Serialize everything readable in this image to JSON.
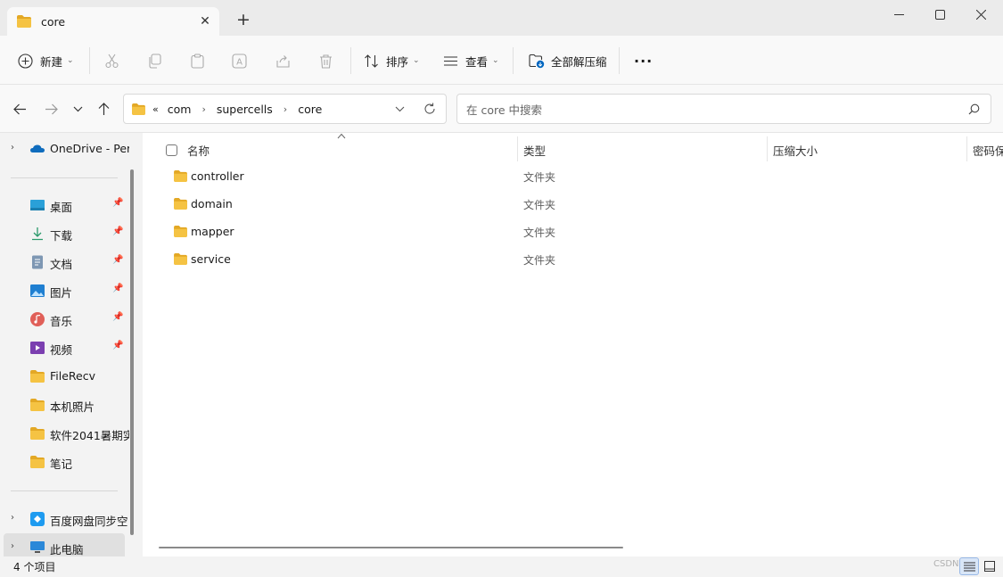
{
  "window": {
    "tab_title": "core",
    "new_tab_symbol": "+",
    "close_tab_symbol": "✕"
  },
  "toolbar": {
    "new_label": "新建",
    "sort_label": "排序",
    "view_label": "查看",
    "extract_label": "全部解压缩",
    "more_label": "···"
  },
  "address": {
    "overflow": "«",
    "crumbs": [
      "com",
      "supercells",
      "core"
    ]
  },
  "search": {
    "placeholder": "在 core 中搜索"
  },
  "sidebar": {
    "onedrive": "OneDrive - Per",
    "quick": [
      {
        "label": "桌面",
        "icon": "desktop-icon",
        "pinned": true
      },
      {
        "label": "下载",
        "icon": "download-icon",
        "pinned": true
      },
      {
        "label": "文档",
        "icon": "document-icon",
        "pinned": true
      },
      {
        "label": "图片",
        "icon": "pictures-icon",
        "pinned": true
      },
      {
        "label": "音乐",
        "icon": "music-icon",
        "pinned": true
      },
      {
        "label": "视频",
        "icon": "video-icon",
        "pinned": true
      },
      {
        "label": "FileRecv",
        "icon": "folder-icon",
        "pinned": false
      },
      {
        "label": "本机照片",
        "icon": "folder-icon",
        "pinned": false
      },
      {
        "label": "软件2041暑期实",
        "icon": "folder-icon",
        "pinned": false
      },
      {
        "label": "笔记",
        "icon": "folder-icon",
        "pinned": false
      }
    ],
    "baidu": "百度网盘同步空",
    "this_pc": "此电脑"
  },
  "columns": {
    "name": "名称",
    "type": "类型",
    "size": "压缩大小",
    "password": "密码保"
  },
  "files": [
    {
      "name": "controller",
      "type": "文件夹"
    },
    {
      "name": "domain",
      "type": "文件夹"
    },
    {
      "name": "mapper",
      "type": "文件夹"
    },
    {
      "name": "service",
      "type": "文件夹"
    }
  ],
  "status": {
    "item_count": "4 个项目",
    "watermark": "CSDN"
  },
  "colors": {
    "folder": "#f5c343",
    "folder_dark": "#e3a825",
    "accent": "#0067c0"
  }
}
